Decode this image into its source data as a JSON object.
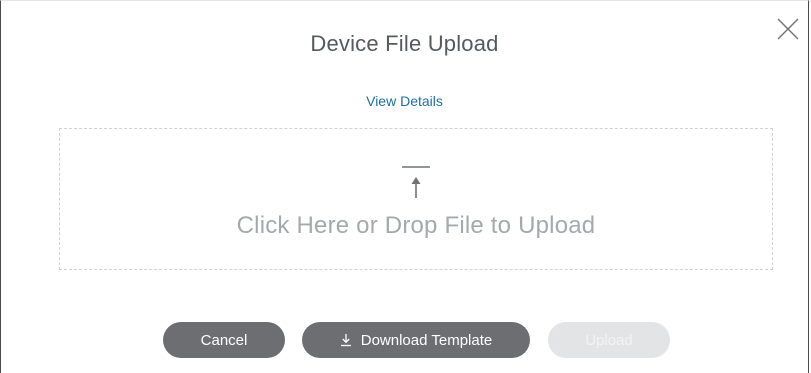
{
  "dialog": {
    "title": "Device File Upload",
    "view_details_label": "View Details",
    "close_icon": "close-icon"
  },
  "dropzone": {
    "text": "Click Here or Drop File to Upload",
    "icon": "upload-icon"
  },
  "actions": {
    "cancel_label": "Cancel",
    "download_label": "Download Template",
    "download_icon": "download-icon",
    "upload_label": "Upload",
    "upload_disabled": true
  },
  "colors": {
    "link": "#1f6fa3",
    "primary_button": "#6c6e72",
    "disabled_button": "#e3e4e5",
    "title_text": "#555a60",
    "placeholder_text": "#a5a9ad"
  }
}
